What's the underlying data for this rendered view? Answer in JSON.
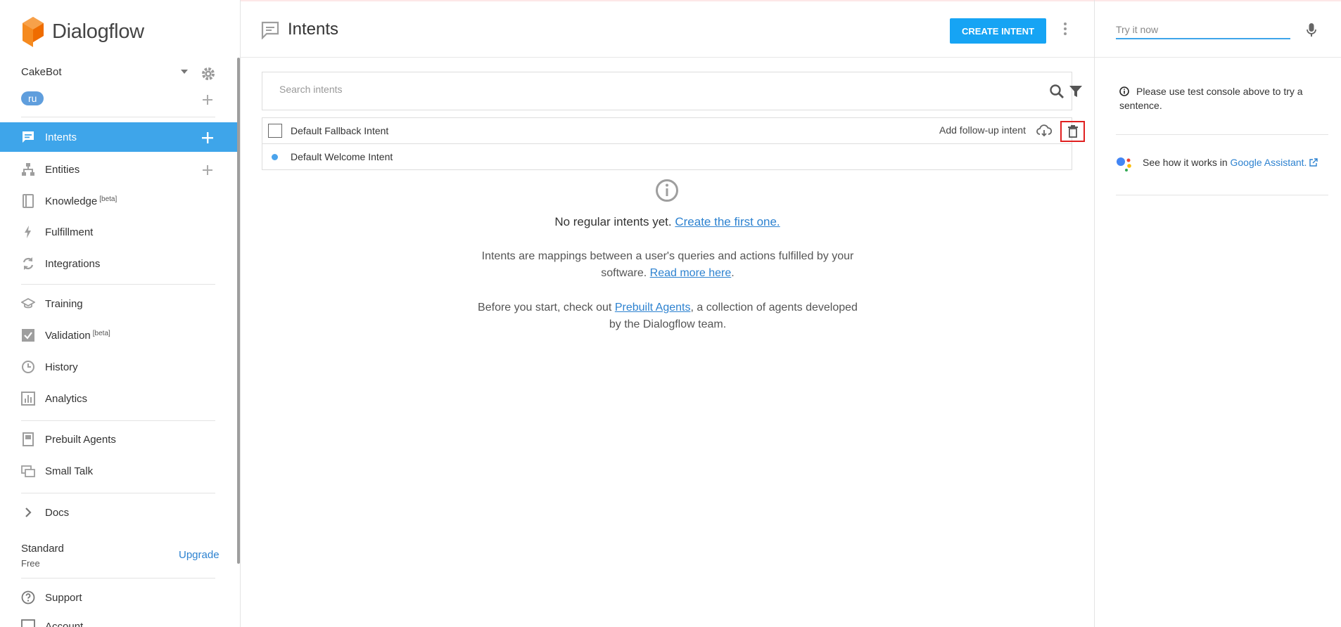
{
  "app": {
    "name": "Dialogflow"
  },
  "agent": {
    "name": "CakeBot",
    "language": "ru"
  },
  "sidebar": {
    "items": [
      {
        "label": "Intents",
        "beta": ""
      },
      {
        "label": "Entities",
        "beta": ""
      },
      {
        "label": "Knowledge",
        "beta": "[beta]"
      },
      {
        "label": "Fulfillment",
        "beta": ""
      },
      {
        "label": "Integrations",
        "beta": ""
      },
      {
        "label": "Training",
        "beta": ""
      },
      {
        "label": "Validation",
        "beta": "[beta]"
      },
      {
        "label": "History",
        "beta": ""
      },
      {
        "label": "Analytics",
        "beta": ""
      },
      {
        "label": "Prebuilt Agents",
        "beta": ""
      },
      {
        "label": "Small Talk",
        "beta": ""
      },
      {
        "label": "Docs",
        "beta": ""
      },
      {
        "label": "Support",
        "beta": ""
      },
      {
        "label": "Account",
        "beta": ""
      }
    ],
    "plan": {
      "name": "Standard",
      "tier": "Free",
      "upgrade_label": "Upgrade"
    }
  },
  "header": {
    "title": "Intents",
    "create_label": "CREATE INTENT"
  },
  "search": {
    "placeholder": "Search intents"
  },
  "intents": [
    {
      "name": "Default Fallback Intent",
      "followup_label": "Add follow-up intent"
    },
    {
      "name": "Default Welcome Intent"
    }
  ],
  "empty": {
    "title": "No regular intents yet.",
    "title_link": "Create the first one.",
    "p1": "Intents are mappings between a user's queries and actions fulfilled by your software.",
    "p1_link": "Read more here",
    "p2_pre": "Before you start, check out",
    "p2_link": "Prebuilt Agents",
    "p2_post": ", a collection of agents developed by the Dialogflow team."
  },
  "console": {
    "placeholder": "Try it now",
    "info": "Please use test console above to try a sentence.",
    "ga_text": "See how it works in",
    "ga_link": "Google Assistant."
  },
  "colors": {
    "accent": "#3ea5ea",
    "button": "#16a4f4",
    "link": "#2d82d0",
    "highlight": "#e02020"
  }
}
